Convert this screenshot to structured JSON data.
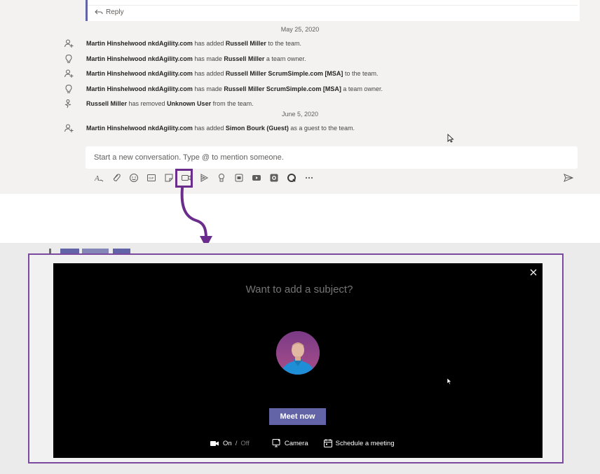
{
  "thread": {
    "reply_label": "Reply"
  },
  "activity": {
    "date1": "May 25, 2020",
    "date2": "June 5, 2020",
    "events": [
      {
        "icon": "person-add-icon",
        "parts": [
          [
            "Martin Hinshelwood nkdAgility.com",
            true
          ],
          [
            " has added ",
            false
          ],
          [
            "Russell Miller",
            true
          ],
          [
            " to the team.",
            false
          ]
        ]
      },
      {
        "icon": "lightbulb-icon",
        "parts": [
          [
            "Martin Hinshelwood nkdAgility.com",
            true
          ],
          [
            " has made ",
            false
          ],
          [
            "Russell Miller",
            true
          ],
          [
            " a team owner.",
            false
          ]
        ]
      },
      {
        "icon": "person-add-icon",
        "parts": [
          [
            "Martin Hinshelwood nkdAgility.com",
            true
          ],
          [
            " has added ",
            false
          ],
          [
            "Russell Miller ScrumSimple.com [MSA]",
            true
          ],
          [
            " to the team.",
            false
          ]
        ]
      },
      {
        "icon": "lightbulb-icon",
        "parts": [
          [
            "Martin Hinshelwood nkdAgility.com",
            true
          ],
          [
            " has made ",
            false
          ],
          [
            "Russell Miller ScrumSimple.com [MSA]",
            true
          ],
          [
            " a team owner.",
            false
          ]
        ]
      },
      {
        "icon": "person-remove-icon",
        "parts": [
          [
            "Russell Miller",
            true
          ],
          [
            " has removed ",
            false
          ],
          [
            "Unknown User",
            true
          ],
          [
            " from the team.",
            false
          ]
        ]
      },
      {
        "icon": "person-add-icon",
        "parts": [
          [
            "Martin Hinshelwood nkdAgility.com",
            true
          ],
          [
            " has added ",
            false
          ],
          [
            "Simon Bourk (Guest)",
            true
          ],
          [
            " as a guest to the team.",
            false
          ]
        ]
      }
    ]
  },
  "compose": {
    "placeholder": "Start a new conversation. Type @ to mention someone."
  },
  "toolbar": {
    "buttons": [
      "format-icon",
      "attach-icon",
      "emoji-icon",
      "gif-icon",
      "sticker-icon",
      "meet-now-icon",
      "stream-icon",
      "praise-icon",
      "app-icon",
      "youtube-icon",
      "camera-app-icon",
      "quiz-icon",
      "more-icon"
    ],
    "highlighted": "meet-now-icon"
  },
  "meeting_dialog": {
    "subject_placeholder": "Want to add a subject?",
    "meet_now_label": "Meet now",
    "video_on_label": "On",
    "video_off_label": "Off",
    "camera_label": "Camera",
    "schedule_label": "Schedule a meeting"
  },
  "colors": {
    "accent": "#6264a7",
    "highlight": "#6b2d8c",
    "dialog_bg": "#000000"
  }
}
